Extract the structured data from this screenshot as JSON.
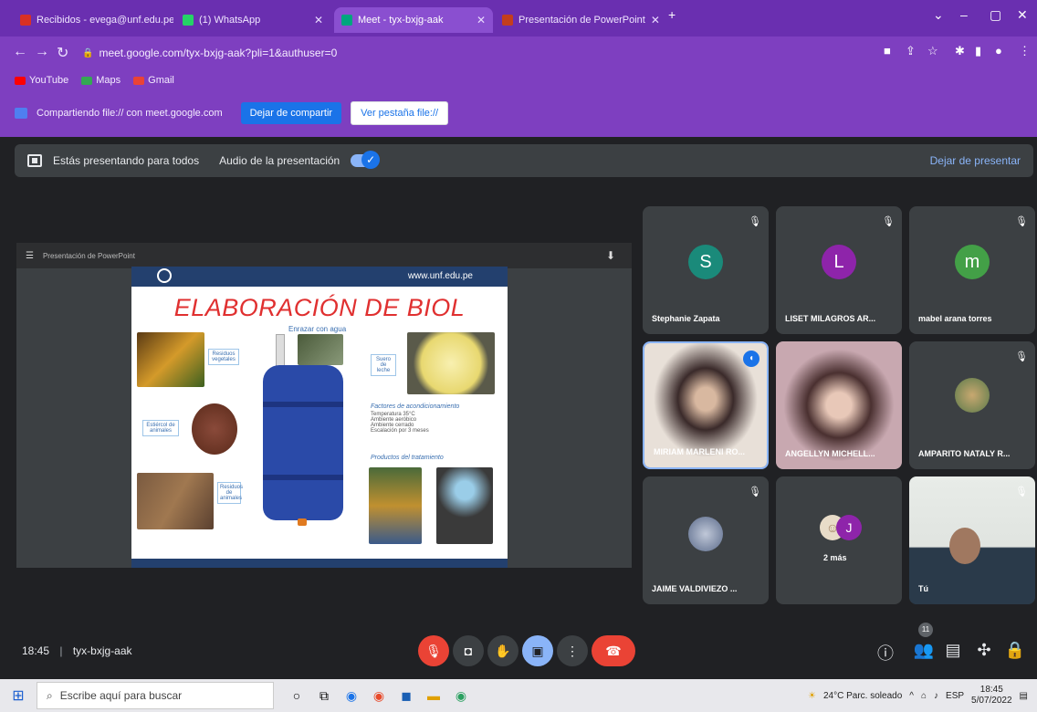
{
  "browser": {
    "tabs": [
      {
        "label": "Recibidos - evega@unf.edu.pe",
        "color": "#d93025"
      },
      {
        "label": "(1) WhatsApp",
        "color": "#25d366"
      },
      {
        "label": "Meet - tyx-bxjg-aak",
        "color": "#00a67e"
      },
      {
        "label": "Presentación de PowerPoint",
        "color": "#c43e1c"
      }
    ],
    "url": "meet.google.com/tyx-bxjg-aak?pli=1&authuser=0",
    "bookmarks": [
      {
        "label": "YouTube",
        "color": "#ff0000"
      },
      {
        "label": "Maps",
        "color": "#34a853"
      },
      {
        "label": "Gmail",
        "color": "#ea4335"
      }
    ]
  },
  "sharebar": {
    "text": "Compartiendo file:// con meet.google.com",
    "stop_label": "Dejar de compartir",
    "hide_label": "Ver pestaña file://"
  },
  "presentbar": {
    "text": "Estás presentando para todos",
    "audio_label": "Audio de la presentación",
    "stop_link": "Dejar de presentar"
  },
  "slide": {
    "toolbar_title": "Presentación de PowerPoint",
    "url": "www.unf.edu.pe",
    "title": "ELABORACIÓN DE BIOL",
    "subtitle": "Enrazar con agua",
    "label_a": "Residuos vegetales",
    "label_b": "Estiércol de animales",
    "label_c": "Residuos de animales",
    "label_d": "Suero de leche",
    "factors_title": "Factores de acondicionamiento",
    "factors": [
      "Temperatura 35°C",
      "Ambiente aeróbico",
      "Ambiente cerrado",
      "Escalación por 3 meses"
    ],
    "product_title": "Productos del tratamiento"
  },
  "participants": [
    {
      "name": "Stephanie Zapata",
      "initial": "S",
      "color": "#1a8a7a",
      "type": "avatar"
    },
    {
      "name": "LISET MILAGROS AR...",
      "initial": "L",
      "color": "#8e24aa",
      "type": "avatar"
    },
    {
      "name": "mabel arana torres",
      "initial": "m",
      "color": "#43a047",
      "type": "avatar"
    },
    {
      "name": "MIRIAM MARLENI RO...",
      "type": "video"
    },
    {
      "name": "ANGELLYN MICHELL...",
      "type": "video"
    },
    {
      "name": "AMPARITO NATALY R...",
      "type": "photo"
    },
    {
      "name": "JAIME VALDIVIEZO ...",
      "type": "photo"
    },
    {
      "name": "2 más",
      "initial": "J",
      "color": "#8e24aa",
      "type": "more"
    },
    {
      "name": "Tú",
      "type": "video"
    }
  ],
  "meeting": {
    "time": "18:45",
    "code": "tyx-bxjg-aak",
    "participant_count": "11"
  },
  "taskbar": {
    "search_placeholder": "Escribe aquí para buscar",
    "weather": "24°C  Parc. soleado",
    "lang": "ESP",
    "clock_time": "18:45",
    "clock_date": "5/07/2022"
  }
}
